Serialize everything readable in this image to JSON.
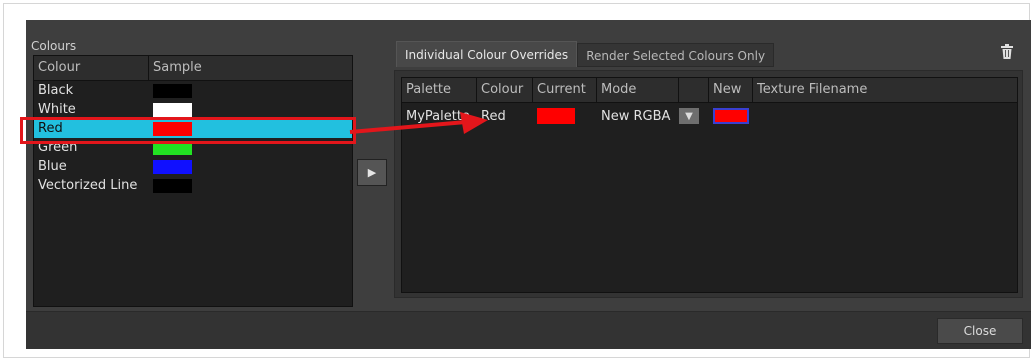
{
  "colours": {
    "label": "Colours",
    "headers": [
      "Colour",
      "Sample"
    ],
    "rows": [
      {
        "name": "Black",
        "color": "#000000",
        "selected": false
      },
      {
        "name": "White",
        "color": "#ffffff",
        "selected": false
      },
      {
        "name": "Red",
        "color": "#ff0000",
        "selected": true
      },
      {
        "name": "Green",
        "color": "#22e322",
        "selected": false
      },
      {
        "name": "Blue",
        "color": "#1010ff",
        "selected": false
      },
      {
        "name": "Vectorized Line",
        "color": "#000000",
        "selected": false
      }
    ]
  },
  "tabs": {
    "active": "Individual Colour Overrides",
    "inactive": "Render Selected Colours Only"
  },
  "overrides": {
    "headers": [
      "Palette",
      "Colour",
      "Current",
      "Mode",
      "",
      "New",
      "Texture Filename"
    ],
    "rows": [
      {
        "palette": "MyPalette",
        "colour": "Red",
        "current_color": "#ff0000",
        "mode": "New RGBA",
        "new_color": "#ff0000",
        "texture": ""
      }
    ]
  },
  "footer": {
    "close_label": "Close"
  },
  "icons": {
    "transfer": "right-arrow-icon",
    "trash": "trash-icon",
    "dropdown": "chevron-down-icon"
  },
  "accent": {
    "selection": "#22c0df",
    "annotation": "#e3161b"
  }
}
